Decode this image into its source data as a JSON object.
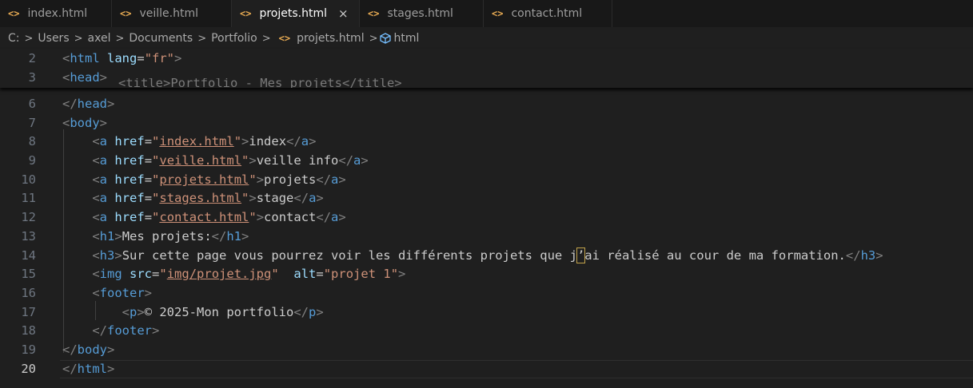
{
  "tabs": [
    {
      "label": "index.html",
      "icon": "<>",
      "active": false
    },
    {
      "label": "veille.html",
      "icon": "<>",
      "active": false
    },
    {
      "label": "projets.html",
      "icon": "<>",
      "active": true,
      "close": "×"
    },
    {
      "label": "stages.html",
      "icon": "<>",
      "active": false
    },
    {
      "label": "contact.html",
      "icon": "<>",
      "active": false
    }
  ],
  "breadcrumb": {
    "parts": [
      "C:",
      "Users",
      "axel",
      "Documents",
      "Portfolio"
    ],
    "file": "projets.html",
    "symbol": "html",
    "separator": ">",
    "file_icon": "<>"
  },
  "editor": {
    "ghost_text": "<title>Portfolio - Mes projets</title>",
    "lines": [
      {
        "num": "2",
        "segments": [
          [
            "p",
            "<"
          ],
          [
            "t",
            "html"
          ],
          [
            "txt",
            " "
          ],
          [
            "a",
            "lang"
          ],
          [
            "txt",
            "="
          ],
          [
            "s",
            "\"fr\""
          ],
          [
            "p",
            ">"
          ]
        ]
      },
      {
        "num": "3",
        "segments": [
          [
            "p",
            "<"
          ],
          [
            "t",
            "head"
          ],
          [
            "p",
            ">"
          ]
        ]
      },
      {
        "num": "6",
        "segments": [
          [
            "p",
            "</"
          ],
          [
            "t",
            "head"
          ],
          [
            "p",
            ">"
          ]
        ]
      },
      {
        "num": "7",
        "segments": [
          [
            "p",
            "<"
          ],
          [
            "t",
            "body"
          ],
          [
            "p",
            ">"
          ]
        ]
      },
      {
        "num": "8",
        "segments": [
          [
            "txt",
            "    "
          ],
          [
            "p",
            "<"
          ],
          [
            "t",
            "a"
          ],
          [
            "txt",
            " "
          ],
          [
            "a",
            "href"
          ],
          [
            "txt",
            "="
          ],
          [
            "s",
            "\""
          ],
          [
            "link",
            "index.html"
          ],
          [
            "s",
            "\""
          ],
          [
            "p",
            ">"
          ],
          [
            "txt",
            "index"
          ],
          [
            "p",
            "</"
          ],
          [
            "t",
            "a"
          ],
          [
            "p",
            ">"
          ]
        ]
      },
      {
        "num": "9",
        "segments": [
          [
            "txt",
            "    "
          ],
          [
            "p",
            "<"
          ],
          [
            "t",
            "a"
          ],
          [
            "txt",
            " "
          ],
          [
            "a",
            "href"
          ],
          [
            "txt",
            "="
          ],
          [
            "s",
            "\""
          ],
          [
            "link",
            "veille.html"
          ],
          [
            "s",
            "\""
          ],
          [
            "p",
            ">"
          ],
          [
            "txt",
            "veille info"
          ],
          [
            "p",
            "</"
          ],
          [
            "t",
            "a"
          ],
          [
            "p",
            ">"
          ]
        ]
      },
      {
        "num": "10",
        "segments": [
          [
            "txt",
            "    "
          ],
          [
            "p",
            "<"
          ],
          [
            "t",
            "a"
          ],
          [
            "txt",
            " "
          ],
          [
            "a",
            "href"
          ],
          [
            "txt",
            "="
          ],
          [
            "s",
            "\""
          ],
          [
            "link",
            "projets.html"
          ],
          [
            "s",
            "\""
          ],
          [
            "p",
            ">"
          ],
          [
            "txt",
            "projets"
          ],
          [
            "p",
            "</"
          ],
          [
            "t",
            "a"
          ],
          [
            "p",
            ">"
          ]
        ]
      },
      {
        "num": "11",
        "segments": [
          [
            "txt",
            "    "
          ],
          [
            "p",
            "<"
          ],
          [
            "t",
            "a"
          ],
          [
            "txt",
            " "
          ],
          [
            "a",
            "href"
          ],
          [
            "txt",
            "="
          ],
          [
            "s",
            "\""
          ],
          [
            "link",
            "stages.html"
          ],
          [
            "s",
            "\""
          ],
          [
            "p",
            ">"
          ],
          [
            "txt",
            "stage"
          ],
          [
            "p",
            "</"
          ],
          [
            "t",
            "a"
          ],
          [
            "p",
            ">"
          ]
        ]
      },
      {
        "num": "12",
        "segments": [
          [
            "txt",
            "    "
          ],
          [
            "p",
            "<"
          ],
          [
            "t",
            "a"
          ],
          [
            "txt",
            " "
          ],
          [
            "a",
            "href"
          ],
          [
            "txt",
            "="
          ],
          [
            "s",
            "\""
          ],
          [
            "link",
            "contact.html"
          ],
          [
            "s",
            "\""
          ],
          [
            "p",
            ">"
          ],
          [
            "txt",
            "contact"
          ],
          [
            "p",
            "</"
          ],
          [
            "t",
            "a"
          ],
          [
            "p",
            ">"
          ]
        ]
      },
      {
        "num": "13",
        "segments": [
          [
            "txt",
            "    "
          ],
          [
            "p",
            "<"
          ],
          [
            "t",
            "h1"
          ],
          [
            "p",
            ">"
          ],
          [
            "txt",
            "Mes projets:"
          ],
          [
            "p",
            "</"
          ],
          [
            "t",
            "h1"
          ],
          [
            "p",
            ">"
          ]
        ]
      },
      {
        "num": "14",
        "segments": [
          [
            "txt",
            "    "
          ],
          [
            "p",
            "<"
          ],
          [
            "t",
            "h3"
          ],
          [
            "p",
            ">"
          ],
          [
            "txt",
            "Sur cette page vous pourrez voir les différents projets que j"
          ],
          [
            "hl",
            "’"
          ],
          [
            "txt",
            "ai réalisé au cour de ma formation."
          ],
          [
            "p",
            "</"
          ],
          [
            "t",
            "h3"
          ],
          [
            "p",
            ">"
          ]
        ]
      },
      {
        "num": "15",
        "segments": [
          [
            "txt",
            "    "
          ],
          [
            "p",
            "<"
          ],
          [
            "t",
            "img"
          ],
          [
            "txt",
            " "
          ],
          [
            "a",
            "src"
          ],
          [
            "txt",
            "="
          ],
          [
            "s",
            "\""
          ],
          [
            "link",
            "img/projet.jpg"
          ],
          [
            "s",
            "\""
          ],
          [
            "txt",
            "  "
          ],
          [
            "a",
            "alt"
          ],
          [
            "txt",
            "="
          ],
          [
            "s",
            "\"projet 1\""
          ],
          [
            "p",
            ">"
          ]
        ]
      },
      {
        "num": "16",
        "segments": [
          [
            "txt",
            "    "
          ],
          [
            "p",
            "<"
          ],
          [
            "t",
            "footer"
          ],
          [
            "p",
            ">"
          ]
        ]
      },
      {
        "num": "17",
        "segments": [
          [
            "txt",
            "        "
          ],
          [
            "p",
            "<"
          ],
          [
            "t",
            "p"
          ],
          [
            "p",
            ">"
          ],
          [
            "txt",
            "© 2025-Mon portfolio"
          ],
          [
            "p",
            "</"
          ],
          [
            "t",
            "p"
          ],
          [
            "p",
            ">"
          ]
        ]
      },
      {
        "num": "18",
        "segments": [
          [
            "txt",
            "    "
          ],
          [
            "p",
            "</"
          ],
          [
            "t",
            "footer"
          ],
          [
            "p",
            ">"
          ]
        ]
      },
      {
        "num": "19",
        "segments": [
          [
            "p",
            "</"
          ],
          [
            "t",
            "body"
          ],
          [
            "p",
            ">"
          ]
        ]
      },
      {
        "num": "20",
        "segments": [
          [
            "p",
            "</"
          ],
          [
            "t",
            "html"
          ],
          [
            "p",
            ">"
          ]
        ],
        "current": true
      }
    ]
  }
}
